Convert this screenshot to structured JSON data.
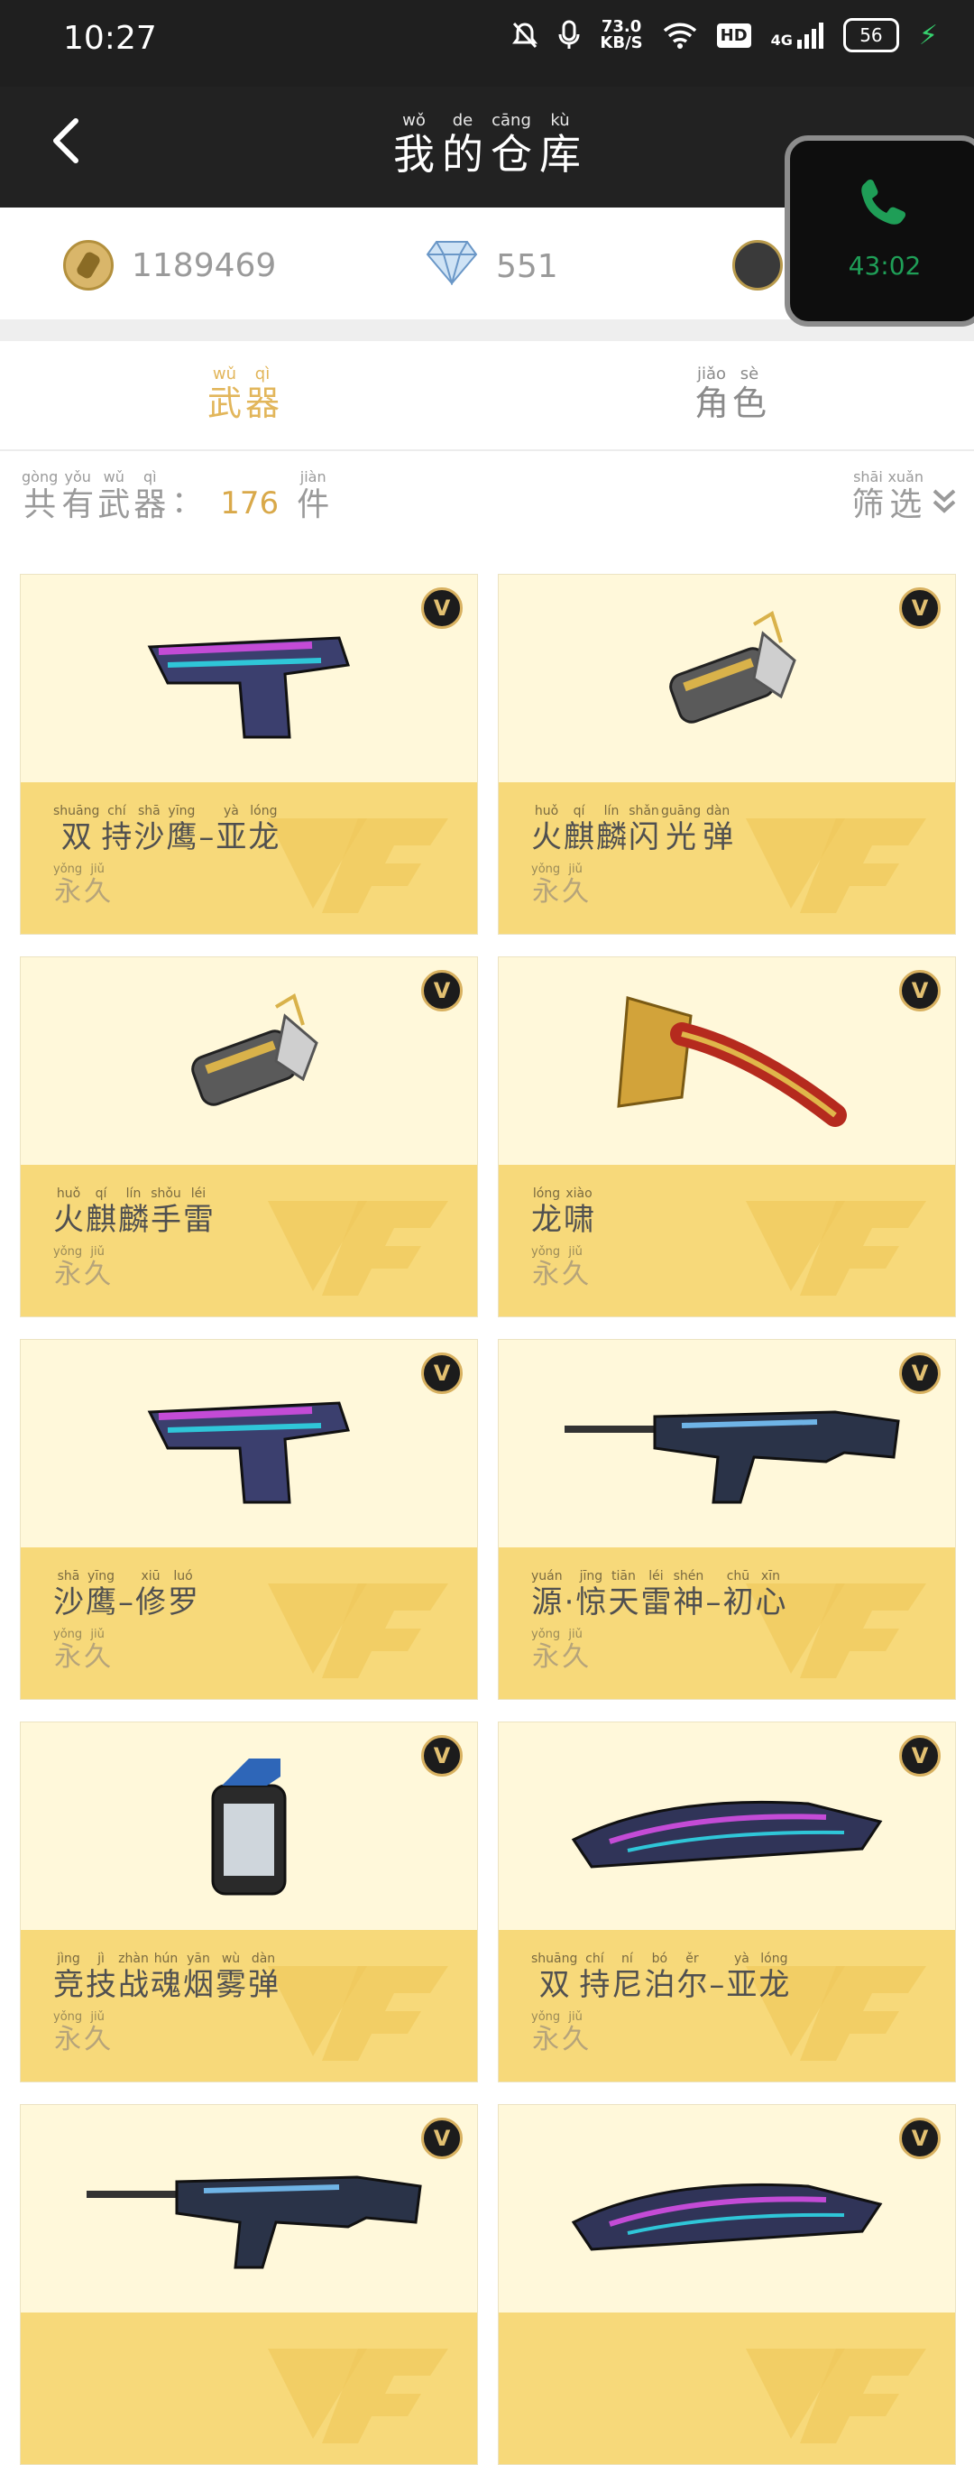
{
  "status": {
    "time": "10:27",
    "net_speed": "73.0",
    "net_unit": "KB/S",
    "hd": "HD",
    "net_type": "4G",
    "battery": "56"
  },
  "header": {
    "title_py": [
      "wǒ",
      "de",
      "cāng",
      "kù"
    ],
    "title_hz": [
      "我",
      "的",
      "仓",
      "库"
    ]
  },
  "currency": {
    "coins": "1189469",
    "gems": "551"
  },
  "call": {
    "duration": "43:02"
  },
  "tabs": [
    {
      "py": [
        "wǔ",
        "qì"
      ],
      "hz": [
        "武",
        "器"
      ],
      "active": true
    },
    {
      "py": [
        "jiǎo",
        "sè"
      ],
      "hz": [
        "角",
        "色"
      ],
      "active": false
    }
  ],
  "summary": {
    "label_py": [
      "gòng",
      "yǒu",
      "wǔ",
      "qì"
    ],
    "label_hz": [
      "共",
      "有",
      "武",
      "器"
    ],
    "colon": "：",
    "count": "176",
    "unit_py": "jiàn",
    "unit_hz": "件",
    "filter_py": [
      "shāi",
      "xuǎn"
    ],
    "filter_hz": [
      "筛",
      "选"
    ]
  },
  "items": [
    {
      "py": [
        "shuāng",
        "chí",
        "shā",
        "yīng",
        "",
        "yà",
        "lóng"
      ],
      "hz": [
        "双",
        "持",
        "沙",
        "鹰",
        "–",
        "亚",
        "龙"
      ],
      "icon": "pistol-icon"
    },
    {
      "py": [
        "huǒ",
        "qí",
        "lín",
        "shǎn",
        "guāng",
        "dàn"
      ],
      "hz": [
        "火",
        "麒",
        "麟",
        "闪",
        "光",
        "弹"
      ],
      "icon": "grenade-icon"
    },
    {
      "py": [
        "huǒ",
        "qí",
        "lín",
        "shǒu",
        "léi"
      ],
      "hz": [
        "火",
        "麒",
        "麟",
        "手",
        "雷"
      ],
      "icon": "grenade-icon"
    },
    {
      "py": [
        "lóng",
        "xiào"
      ],
      "hz": [
        "龙",
        "啸"
      ],
      "icon": "axe-icon"
    },
    {
      "py": [
        "shā",
        "yīng",
        "",
        "xiū",
        "luó"
      ],
      "hz": [
        "沙",
        "鹰",
        "–",
        "修",
        "罗"
      ],
      "icon": "pistol-icon"
    },
    {
      "py": [
        "yuán",
        "",
        "jīng",
        "tiān",
        "léi",
        "shén",
        "",
        "chū",
        "xīn"
      ],
      "hz": [
        "源",
        "·",
        "惊",
        "天",
        "雷",
        "神",
        "–",
        "初",
        "心"
      ],
      "icon": "rifle-icon"
    },
    {
      "py": [
        "jìng",
        "jì",
        "zhàn",
        "hún",
        "yān",
        "wù",
        "dàn"
      ],
      "hz": [
        "竞",
        "技",
        "战",
        "魂",
        "烟",
        "雾",
        "弹"
      ],
      "icon": "smoke-grenade-icon"
    },
    {
      "py": [
        "shuāng",
        "chí",
        "ní",
        "bó",
        "ěr",
        "",
        "yà",
        "lóng"
      ],
      "hz": [
        "双",
        "持",
        "尼",
        "泊",
        "尔",
        "–",
        "亚",
        "龙"
      ],
      "icon": "knife-icon"
    },
    {
      "py": [],
      "hz": [],
      "icon": "rifle-icon"
    },
    {
      "py": [],
      "hz": [],
      "icon": "knife-icon"
    }
  ],
  "duration_py": [
    "yǒng",
    "jiǔ"
  ],
  "duration_hz": [
    "永",
    "久"
  ],
  "vip_badge": "V",
  "colors": {
    "gold": "#e2b65b",
    "card_top": "#fff8da",
    "card_bottom": "#f7d97a",
    "call_green": "#1f9e57"
  }
}
